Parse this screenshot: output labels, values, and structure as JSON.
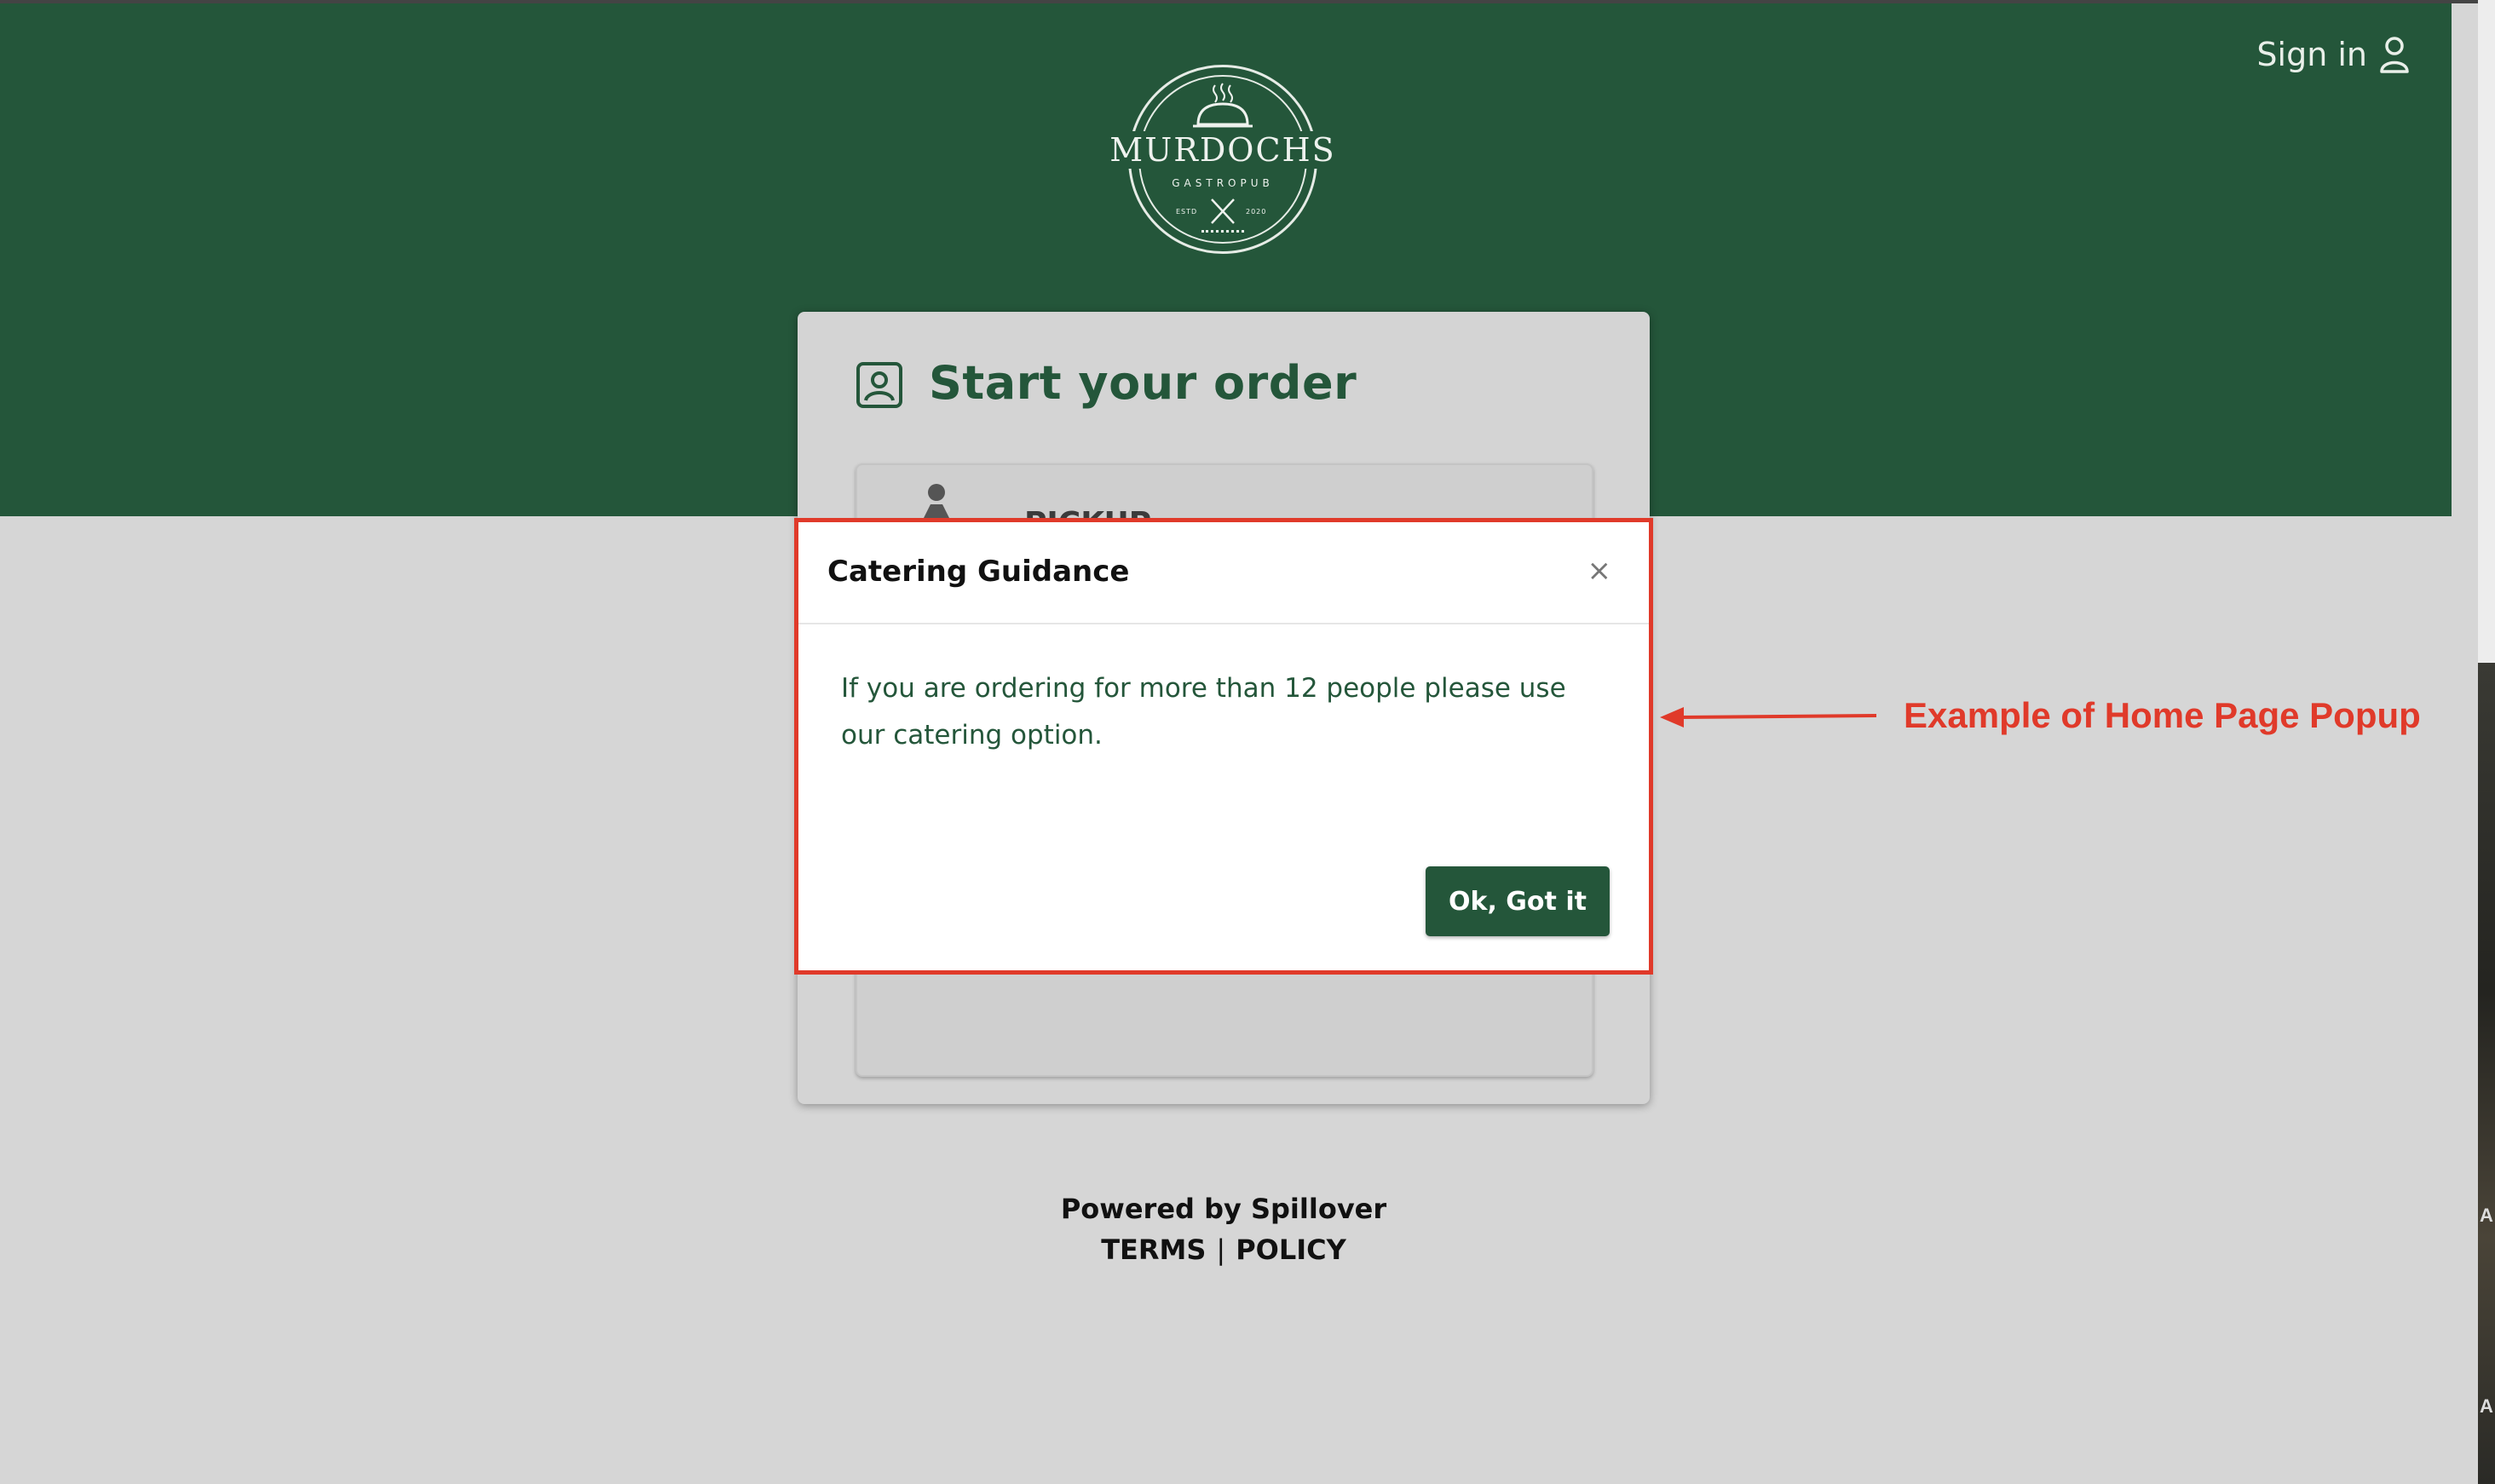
{
  "header": {
    "signin_label": "Sign in",
    "brand": {
      "name": "MURDOCHS",
      "tagline": "GASTROPUB",
      "estd_left": "ESTD",
      "estd_right": "2020"
    }
  },
  "order_card": {
    "title": "Start your order",
    "options": [
      {
        "label": "PICKUP",
        "icon": "person-icon"
      },
      {
        "label": "",
        "icon": "globe-icon"
      }
    ]
  },
  "modal": {
    "title": "Catering Guidance",
    "close_symbol": "×",
    "body": "If you are ordering for more than 12 people please use our catering option.",
    "confirm_label": "Ok, Got it"
  },
  "annotation": {
    "text": "Example of Home Page Popup",
    "color": "#e03a2a"
  },
  "footer": {
    "powered_by": "Powered by Spillover",
    "terms_label": "TERMS",
    "separator": "|",
    "policy_label": "POLICY"
  },
  "colors": {
    "brand_green": "#24563a",
    "page_background": "#d6d6d6",
    "annotation_red": "#e03a2a"
  }
}
